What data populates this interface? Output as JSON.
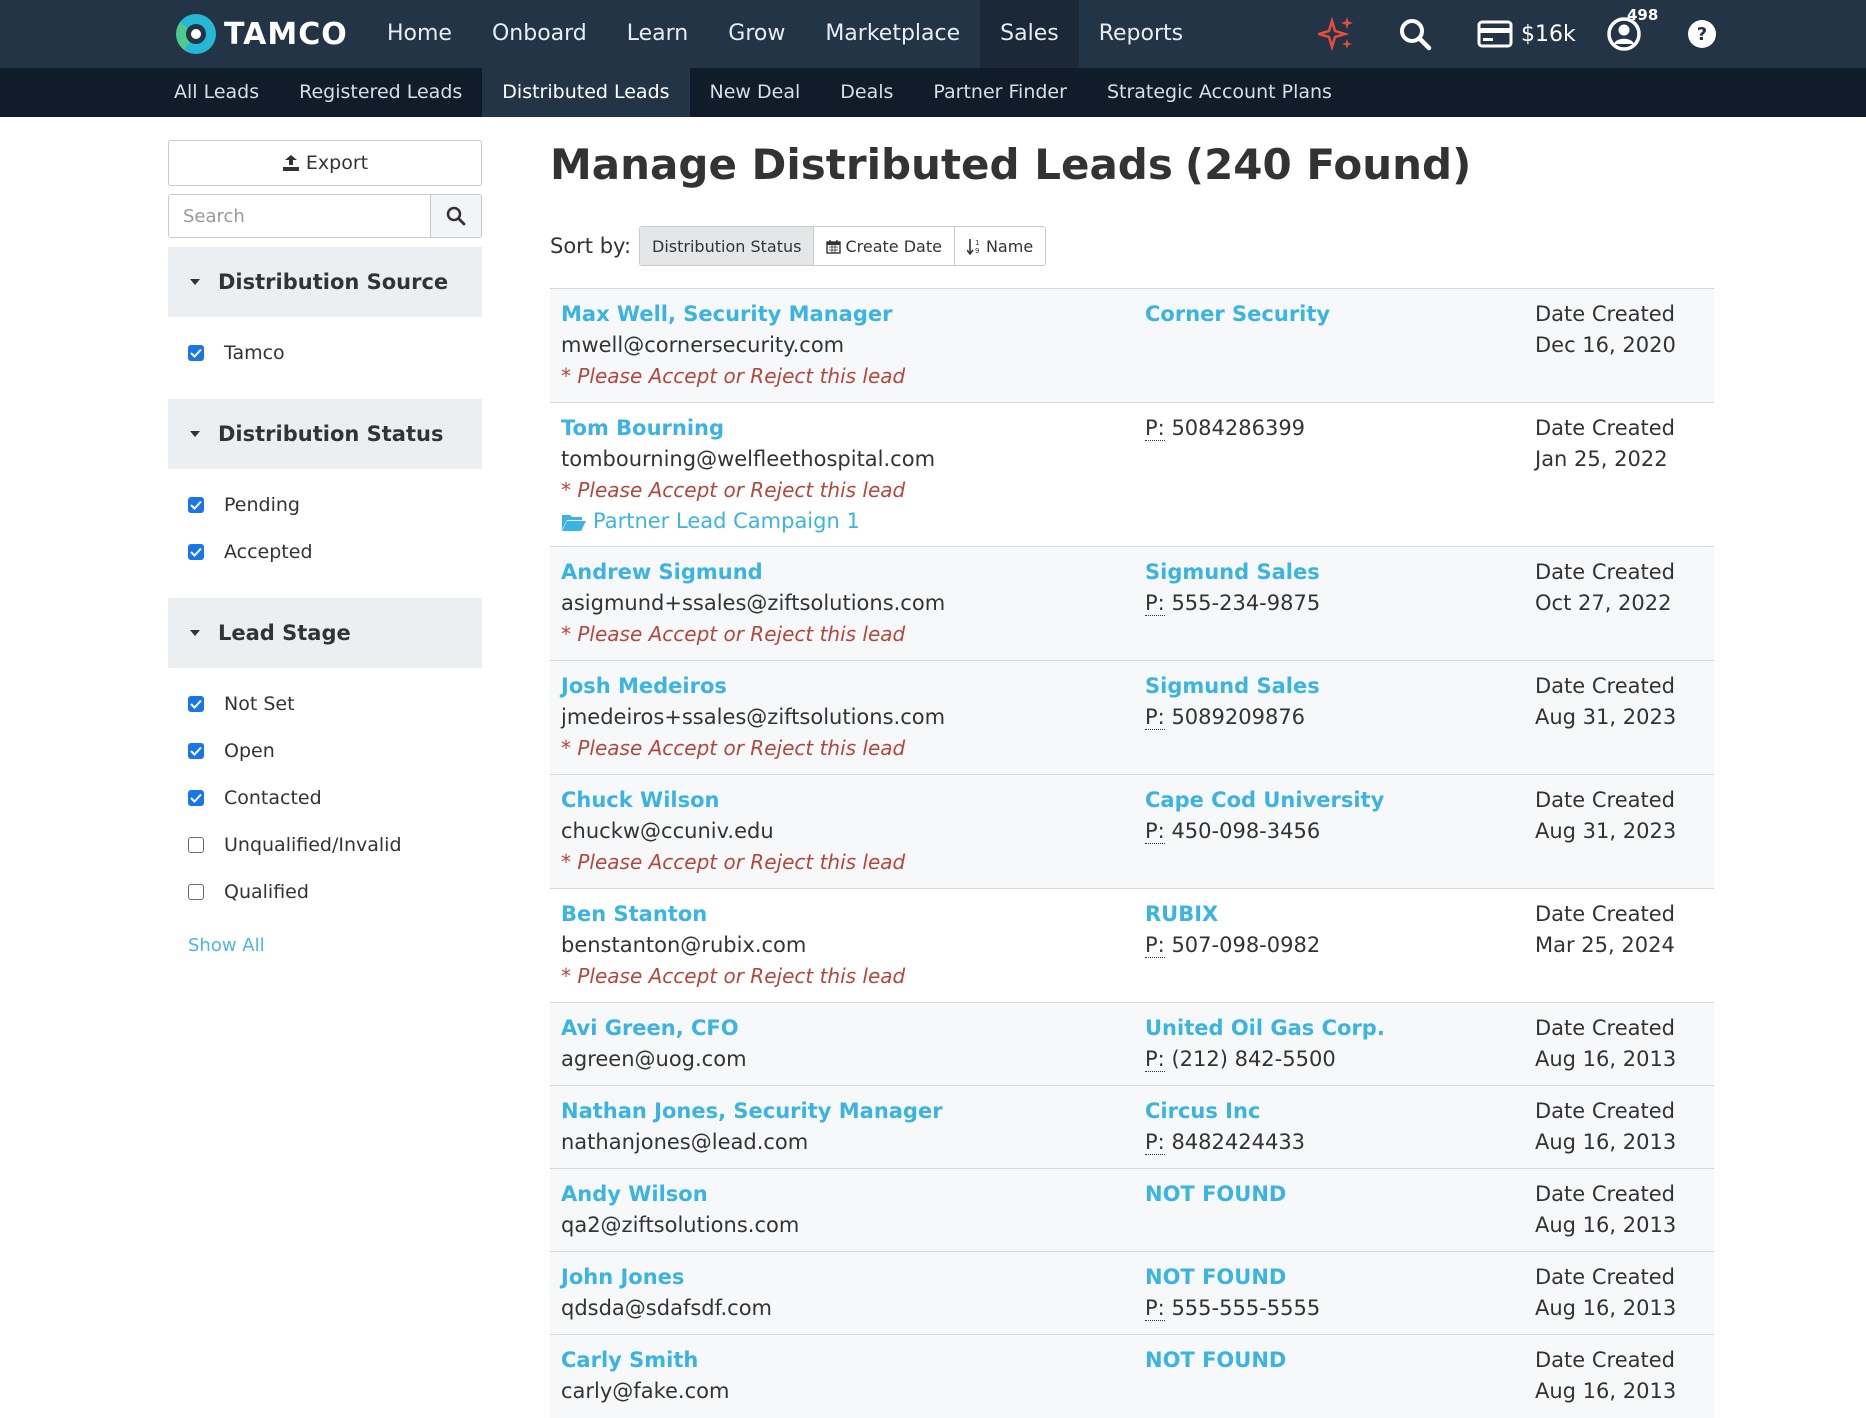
{
  "brand": {
    "name": "TAMCO"
  },
  "nav": {
    "items": [
      {
        "label": "Home"
      },
      {
        "label": "Onboard"
      },
      {
        "label": "Learn"
      },
      {
        "label": "Grow"
      },
      {
        "label": "Marketplace"
      },
      {
        "label": "Sales"
      },
      {
        "label": "Reports"
      }
    ],
    "active": "Sales",
    "budget": "$16k",
    "notifications": "498",
    "icons": [
      "sparkle-icon",
      "search-icon",
      "credit-card-icon",
      "user-icon",
      "help-icon"
    ]
  },
  "subnav": {
    "items": [
      {
        "label": "All Leads"
      },
      {
        "label": "Registered Leads"
      },
      {
        "label": "Distributed Leads"
      },
      {
        "label": "New Deal"
      },
      {
        "label": "Deals"
      },
      {
        "label": "Partner Finder"
      },
      {
        "label": "Strategic Account Plans"
      }
    ],
    "active": "Distributed Leads"
  },
  "sidebar": {
    "export_label": "Export",
    "search_placeholder": "Search",
    "groups": [
      {
        "title": "Distribution Source",
        "items": [
          {
            "label": "Tamco",
            "checked": true
          }
        ]
      },
      {
        "title": "Distribution Status",
        "items": [
          {
            "label": "Pending",
            "checked": true
          },
          {
            "label": "Accepted",
            "checked": true
          }
        ]
      },
      {
        "title": "Lead Stage",
        "items": [
          {
            "label": "Not Set",
            "checked": true
          },
          {
            "label": "Open",
            "checked": true
          },
          {
            "label": "Contacted",
            "checked": true
          },
          {
            "label": "Unqualified/Invalid",
            "checked": false
          },
          {
            "label": "Qualified",
            "checked": false
          }
        ]
      }
    ],
    "show_all": "Show All"
  },
  "main": {
    "title": "Manage Distributed Leads",
    "count": "(240 Found)",
    "sort_label": "Sort by:",
    "sort_options": [
      {
        "label": "Distribution Status"
      },
      {
        "label": "Create Date"
      },
      {
        "label": "Name"
      }
    ],
    "date_label": "Date Created",
    "phone_prefix": "P:",
    "leads": [
      {
        "name": "Max Well, Security Manager",
        "email": "mwell@cornersecurity.com",
        "warning": "* Please Accept or Reject this lead",
        "campaign": "",
        "company": "Corner Security",
        "phone": "",
        "date": "Dec 16, 2020"
      },
      {
        "name": "Tom Bourning",
        "email": "tombourning@welfleethospital.com",
        "warning": "* Please Accept or Reject this lead",
        "campaign": "Partner Lead Campaign 1",
        "company": "",
        "phone": "5084286399",
        "date": "Jan 25, 2022"
      },
      {
        "name": "Andrew Sigmund",
        "email": "asigmund+ssales@ziftsolutions.com",
        "warning": "* Please Accept or Reject this lead",
        "campaign": "",
        "company": "Sigmund Sales",
        "phone": "555-234-9875",
        "date": "Oct 27, 2022"
      },
      {
        "name": "Josh Medeiros",
        "email": "jmedeiros+ssales@ziftsolutions.com",
        "warning": "* Please Accept or Reject this lead",
        "campaign": "",
        "company": "Sigmund Sales",
        "phone": "5089209876",
        "date": "Aug 31, 2023"
      },
      {
        "name": "Chuck Wilson",
        "email": "chuckw@ccuniv.edu",
        "warning": "* Please Accept or Reject this lead",
        "campaign": "",
        "company": "Cape Cod University",
        "phone": "450-098-3456",
        "date": "Aug 31, 2023"
      },
      {
        "name": "Ben Stanton",
        "email": "benstanton@rubix.com",
        "warning": "* Please Accept or Reject this lead",
        "campaign": "",
        "company": "RUBIX",
        "phone": "507-098-0982",
        "date": "Mar 25, 2024"
      },
      {
        "name": "Avi Green, CFO",
        "email": "agreen@uog.com",
        "warning": "",
        "campaign": "",
        "company": "United Oil Gas Corp.",
        "phone": "(212) 842-5500",
        "date": "Aug 16, 2013"
      },
      {
        "name": "Nathan Jones, Security Manager",
        "email": "nathanjones@lead.com",
        "warning": "",
        "campaign": "",
        "company": "Circus Inc",
        "phone": "8482424433",
        "date": "Aug 16, 2013"
      },
      {
        "name": "Andy Wilson",
        "email": "qa2@ziftsolutions.com",
        "warning": "",
        "campaign": "",
        "company": "NOT FOUND",
        "phone": "",
        "date": "Aug 16, 2013"
      },
      {
        "name": "John Jones",
        "email": "qdsda@sdafsdf.com",
        "warning": "",
        "campaign": "",
        "company": "NOT FOUND",
        "phone": "555-555-5555",
        "date": "Aug 16, 2013"
      },
      {
        "name": "Carly Smith",
        "email": "carly@fake.com",
        "warning": "",
        "campaign": "",
        "company": "NOT FOUND",
        "phone": "",
        "date": "Aug 16, 2013"
      }
    ]
  },
  "colors": {
    "nav_bg": "#233447",
    "subnav_bg": "#111c2b",
    "link": "#3bb3e3",
    "warning": "#b5463c",
    "checkbox": "#1976e8"
  }
}
